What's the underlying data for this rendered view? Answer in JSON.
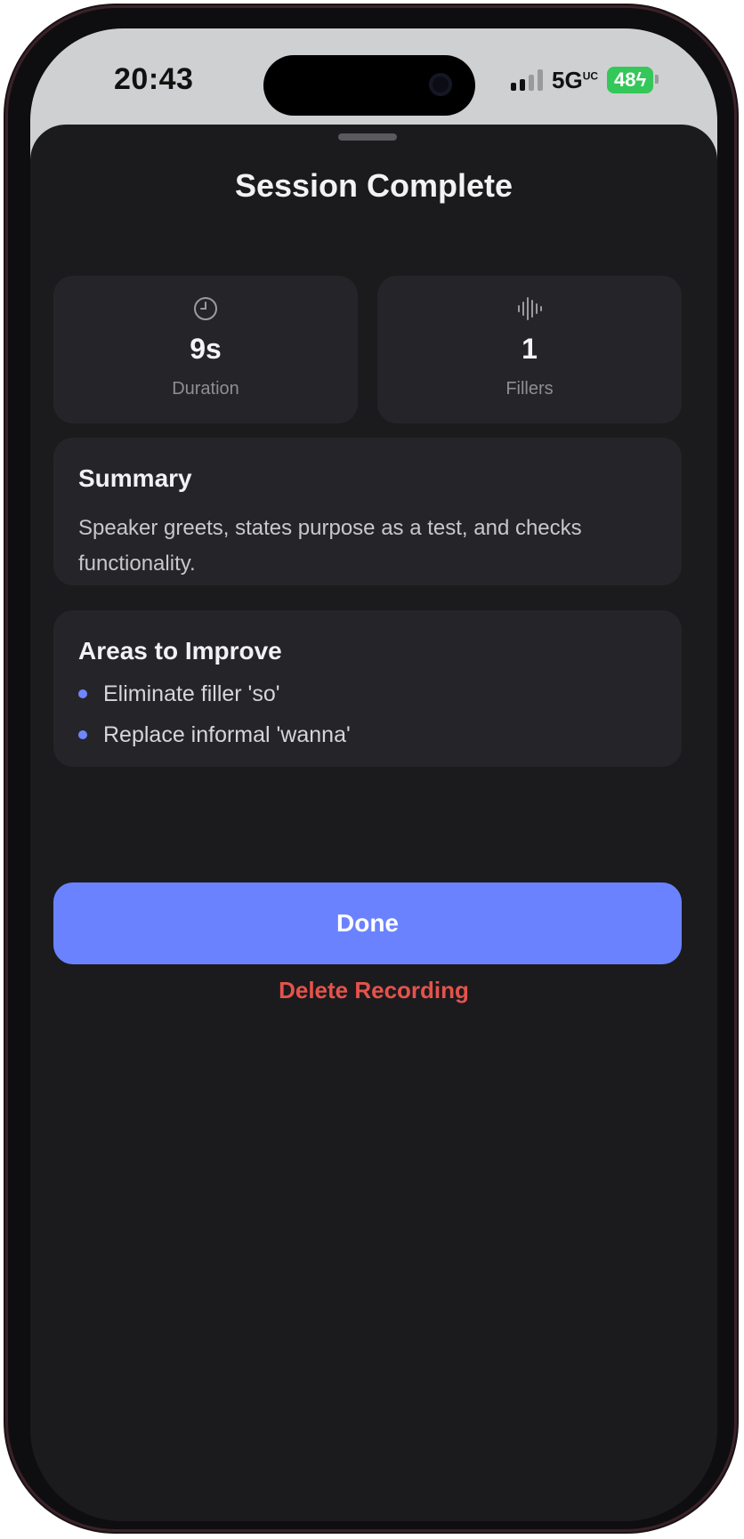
{
  "status_bar": {
    "time": "20:43",
    "network": "5G",
    "network_suffix": "UC",
    "battery": "48"
  },
  "sheet": {
    "title": "Session Complete"
  },
  "stats": [
    {
      "icon": "clock-icon",
      "value": "9s",
      "label": "Duration"
    },
    {
      "icon": "waveform-icon",
      "value": "1",
      "label": "Fillers"
    }
  ],
  "summary": {
    "heading": "Summary",
    "text": "Speaker greets, states purpose as a test, and checks functionality."
  },
  "improve": {
    "heading": "Areas to Improve",
    "items": [
      "Eliminate filler 'so'",
      "Replace informal 'wanna'"
    ]
  },
  "actions": {
    "done_label": "Done",
    "delete_label": "Delete Recording"
  },
  "colors": {
    "accent": "#6b82ff",
    "danger": "#e5534b",
    "sheet_bg": "#1b1b1e",
    "card_bg": "#252529"
  }
}
